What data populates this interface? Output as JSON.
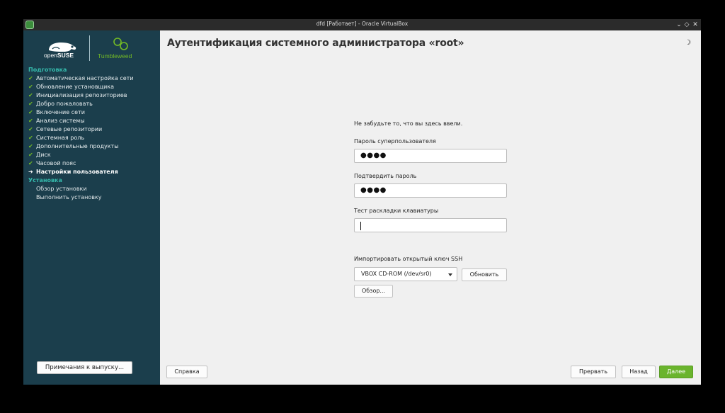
{
  "window": {
    "title": "dfd [Работает] - Oracle VirtualBox",
    "controls": [
      "⌄",
      "◇",
      "✕"
    ]
  },
  "logo": {
    "opensuse_prefix": "open",
    "opensuse_name": "SUSE",
    "product": "Tumbleweed"
  },
  "sidebar": {
    "sections": [
      {
        "title": "Подготовка",
        "items": [
          {
            "label": "Автоматическая настройка сети",
            "state": "done"
          },
          {
            "label": "Обновление установщика",
            "state": "done"
          },
          {
            "label": "Инициализация репозиториев",
            "state": "done"
          },
          {
            "label": "Добро пожаловать",
            "state": "done"
          },
          {
            "label": "Включение сети",
            "state": "done"
          },
          {
            "label": "Анализ системы",
            "state": "done"
          },
          {
            "label": "Сетевые репозитории",
            "state": "done"
          },
          {
            "label": "Системная роль",
            "state": "done"
          },
          {
            "label": "Дополнительные продукты",
            "state": "done"
          },
          {
            "label": "Диск",
            "state": "done"
          },
          {
            "label": "Часовой пояс",
            "state": "done"
          },
          {
            "label": "Настройки пользователя",
            "state": "current"
          }
        ]
      },
      {
        "title": "Установка",
        "items": [
          {
            "label": "Обзор установки",
            "state": "pending"
          },
          {
            "label": "Выполнить установку",
            "state": "pending"
          }
        ]
      }
    ],
    "marks": {
      "done": "✔",
      "current": "➔"
    },
    "release_notes_label": "Примечания к выпуску..."
  },
  "main": {
    "title": "Аутентификация системного администратора «root»",
    "theme_icon": "☽",
    "hint": "Не забудьте то, что вы здесь ввели.",
    "password_label": "Пароль суперпользователя",
    "password_value": "●●●●",
    "confirm_label": "Подтвердить пароль",
    "confirm_value": "●●●●",
    "keyboard_test_label": "Тест раскладки клавиатуры",
    "keyboard_test_value": "",
    "ssh_label": "Импортировать открытый ключ SSH",
    "ssh_device": "VBOX CD-ROM (/dev/sr0)",
    "refresh_label": "Обновить",
    "browse_label": "Обзор..."
  },
  "footer": {
    "help_label": "Справка",
    "abort_label": "Прервать",
    "back_label": "Назад",
    "next_label": "Далее"
  }
}
